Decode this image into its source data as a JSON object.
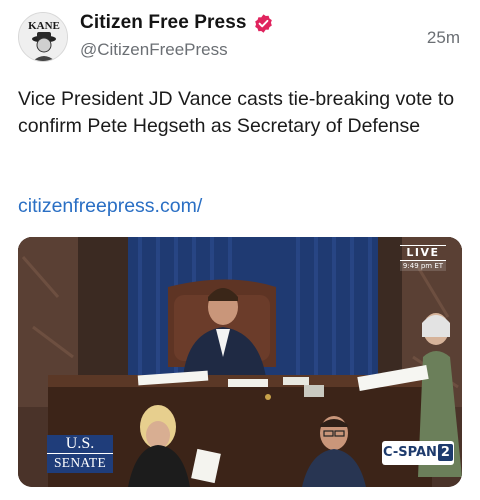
{
  "post": {
    "author": {
      "display_name": "Citizen Free Press",
      "handle": "@CitizenFreePress",
      "avatar_text": "KANE",
      "verified": true
    },
    "timestamp": "25m",
    "text": "Vice President JD Vance casts tie-breaking vote to confirm Pete Hegseth as Secretary of Defense",
    "link": "citizenfreepress.com/",
    "media": {
      "live_label": "LIVE",
      "live_time": "9:49 pm ET",
      "senate_badge": {
        "line1": "U.S.",
        "line2": "SENATE"
      },
      "network_badge": {
        "prefix": "C-SPAN",
        "number": "2"
      }
    }
  },
  "colors": {
    "link": "#2a6fc4",
    "verified_badge": "#e0245e",
    "handle": "#6b6f74",
    "curtain": "#1f3a72",
    "senate_badge": "#1f3d7a"
  }
}
